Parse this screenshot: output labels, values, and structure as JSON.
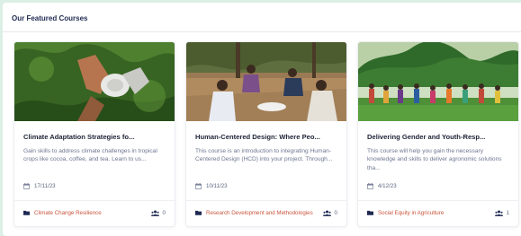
{
  "section": {
    "title": "Our Featured Courses"
  },
  "courses": [
    {
      "title": "Climate Adaptation Strategies fo...",
      "description": "Gain skills to address climate challenges in tropical crops like cocoa, coffee, and tea. Learn to us...",
      "date": "17/11/23",
      "category": "Climate Change Resilience",
      "enrolled": "0",
      "image_icon": "farmer-with-hat-image"
    },
    {
      "title": "Human-Centered Design: Where Peo...",
      "description": "This course is an introduction to integrating Human-Centered Design (HCD) into your project. Through...",
      "date": "10/11/23",
      "category": "Research Development and Methodologies",
      "enrolled": "0",
      "image_icon": "group-meeting-image"
    },
    {
      "title": "Delivering Gender and Youth-Resp...",
      "description": "This course will help you gain the necessary knowledge and skills to deliver agronomic solutions tha...",
      "date": "4/12/23",
      "category": "Social Equity in Agriculture",
      "enrolled": "1",
      "image_icon": "women-in-field-image"
    }
  ],
  "colors": {
    "accent": "#c8553d",
    "title": "#1e2a52",
    "background": "#dcefe6"
  }
}
